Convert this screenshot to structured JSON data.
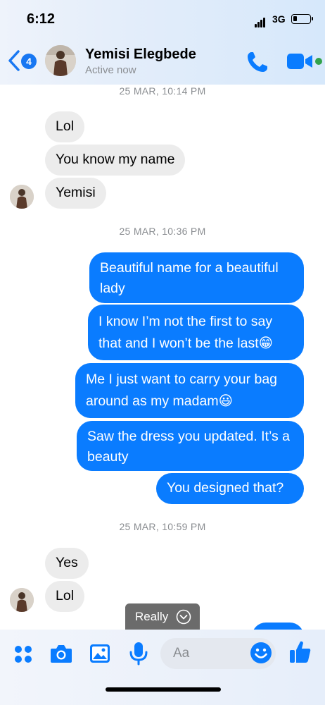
{
  "status_bar": {
    "time": "6:12",
    "network": "3G"
  },
  "header": {
    "back_badge": "4",
    "contact_name": "Yemisi Elegbede",
    "contact_status": "Active now"
  },
  "messages": {
    "ts1": "25 MAR, 10:14 PM",
    "in1": "Lol",
    "in2": "You know my name",
    "in3": "Yemisi",
    "ts2": "25 MAR, 10:36 PM",
    "out1": "Beautiful name for a beautiful lady",
    "out2": "I know I’m not the first to say that and I won’t be the last😁",
    "out3": "Me I just want to carry your bag around as my madam😃",
    "out4": "Saw the dress you updated. It’s a beauty",
    "out5": "You designed that?",
    "ts3": "25 MAR, 10:59 PM",
    "in4": "Yes",
    "in5": "Lol"
  },
  "reply_chip": {
    "label": "Really"
  },
  "composer": {
    "placeholder": "Aa"
  },
  "colors": {
    "accent": "#0a7cff",
    "incoming": "#ececec",
    "online": "#31a24c"
  }
}
